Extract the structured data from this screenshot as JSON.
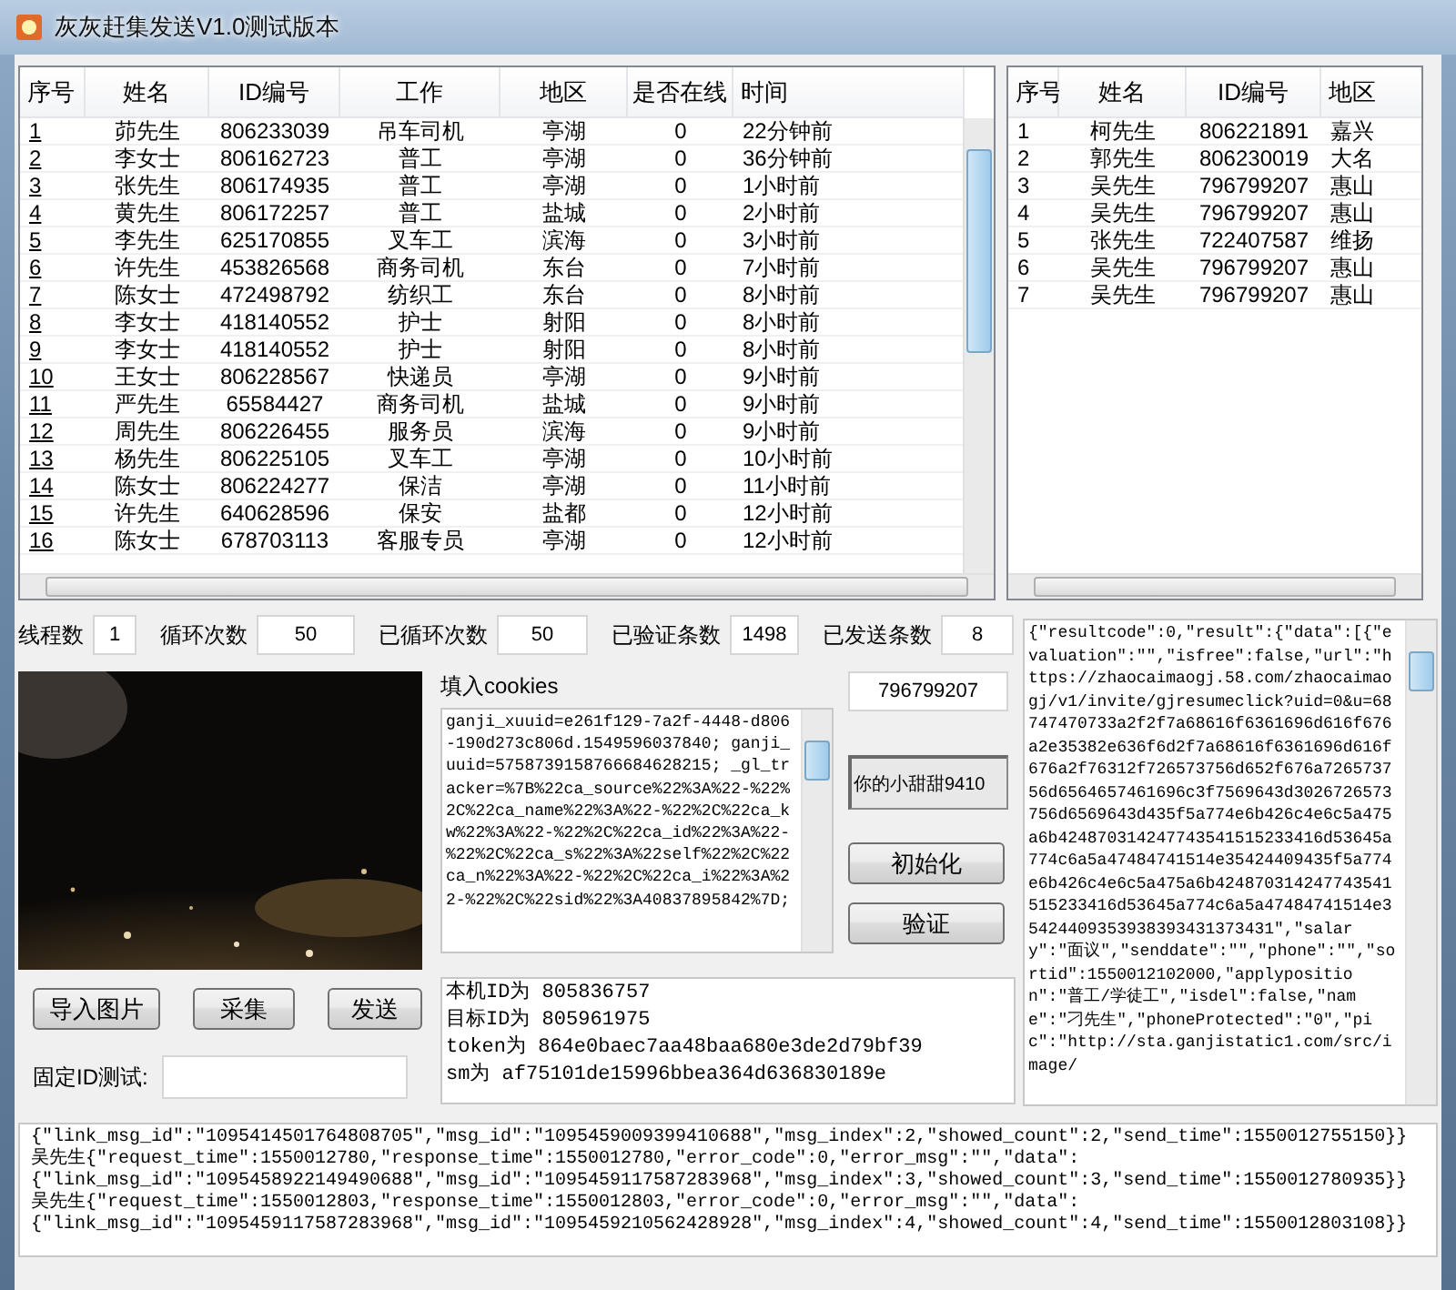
{
  "window": {
    "title": "灰灰赶集发送V1.0测试版本"
  },
  "main_table": {
    "linked_index": true,
    "columns": [
      "序号",
      "姓名",
      "ID编号",
      "工作",
      "地区",
      "是否在线",
      "时间"
    ],
    "rows": [
      [
        "1",
        "茆先生",
        "806233039",
        "吊车司机",
        "亭湖",
        "0",
        "22分钟前"
      ],
      [
        "2",
        "李女士",
        "806162723",
        "普工",
        "亭湖",
        "0",
        "36分钟前"
      ],
      [
        "3",
        "张先生",
        "806174935",
        "普工",
        "亭湖",
        "0",
        "1小时前"
      ],
      [
        "4",
        "黄先生",
        "806172257",
        "普工",
        "盐城",
        "0",
        "2小时前"
      ],
      [
        "5",
        "李先生",
        "625170855",
        "叉车工",
        "滨海",
        "0",
        "3小时前"
      ],
      [
        "6",
        "许先生",
        "453826568",
        "商务司机",
        "东台",
        "0",
        "7小时前"
      ],
      [
        "7",
        "陈女士",
        "472498792",
        "纺织工",
        "东台",
        "0",
        "8小时前"
      ],
      [
        "8",
        "李女士",
        "418140552",
        "护士",
        "射阳",
        "0",
        "8小时前"
      ],
      [
        "9",
        "李女士",
        "418140552",
        "护士",
        "射阳",
        "0",
        "8小时前"
      ],
      [
        "10",
        "王女士",
        "806228567",
        "快递员",
        "亭湖",
        "0",
        "9小时前"
      ],
      [
        "11",
        "严先生",
        "65584427",
        "商务司机",
        "盐城",
        "0",
        "9小时前"
      ],
      [
        "12",
        "周先生",
        "806226455",
        "服务员",
        "滨海",
        "0",
        "9小时前"
      ],
      [
        "13",
        "杨先生",
        "806225105",
        "叉车工",
        "亭湖",
        "0",
        "10小时前"
      ],
      [
        "14",
        "陈女士",
        "806224277",
        "保洁",
        "亭湖",
        "0",
        "11小时前"
      ],
      [
        "15",
        "许先生",
        "640628596",
        "保安",
        "盐都",
        "0",
        "12小时前"
      ],
      [
        "16",
        "陈女士",
        "678703113",
        "客服专员",
        "亭湖",
        "0",
        "12小时前"
      ]
    ]
  },
  "side_table": {
    "linked_index": false,
    "columns": [
      "序号",
      "姓名",
      "ID编号",
      "地区"
    ],
    "rows": [
      [
        "1",
        "柯先生",
        "806221891",
        "嘉兴"
      ],
      [
        "2",
        "郭先生",
        "806230019",
        "大名"
      ],
      [
        "3",
        "吴先生",
        "796799207",
        "惠山"
      ],
      [
        "4",
        "吴先生",
        "796799207",
        "惠山"
      ],
      [
        "5",
        "张先生",
        "722407587",
        "维扬"
      ],
      [
        "6",
        "吴先生",
        "796799207",
        "惠山"
      ],
      [
        "7",
        "吴先生",
        "796799207",
        "惠山"
      ]
    ]
  },
  "counters": [
    {
      "label": "线程数",
      "value": "1"
    },
    {
      "label": "循环次数",
      "value": "50"
    },
    {
      "label": "已循环次数",
      "value": "50"
    },
    {
      "label": "已验证条数",
      "value": "1498"
    },
    {
      "label": "已发送条数",
      "value": "8"
    }
  ],
  "banner": {
    "kind": "picture"
  },
  "left_buttons": [
    "导入图片",
    "采集",
    "发送"
  ],
  "fixed_id": {
    "label": "固定ID测试:"
  },
  "cookies": {
    "label": "填入cookies",
    "value": "ganji_xuuid=e261f129-7a2f-4448-d806-190d273c806d.1549596037840; ganji_uuid=5758739158766684628215; _gl_tracker=%7B%22ca_source%22%3A%22-%22%2C%22ca_name%22%3A%22-%22%2C%22ca_kw%22%3A%22-%22%2C%22ca_id%22%3A%22-%22%2C%22ca_s%22%3A%22self%22%2C%22ca_n%22%3A%22-%22%2C%22ca_i%22%3A%22-%22%2C%22sid%22%3A40837895842%7D;"
  },
  "id_field": {
    "value": "796799207"
  },
  "nickname_field": {
    "value": "你的小甜甜9410",
    "disabled": true
  },
  "action_buttons": [
    "初始化",
    "验证"
  ],
  "info_lines": [
    "本机ID为 805836757",
    "目标ID为 805961975",
    "token为 864e0baec7aa48baa680e3de2d79bf39",
    "sm为 af75101de15996bbea364d636830189e"
  ],
  "response": "{\"resultcode\":0,\"result\":{\"data\":[{\"evaluation\":\"\",\"isfree\":false,\"url\":\"https://zhaocaimaogj.58.com/zhaocaimaogj/v1/invite/gjresumeclick?uid=0&u=68747470733a2f2f7a68616f6361696d616f676a2e35382e636f6d2f7a68616f6361696d616f676a2f76312f726573756d652f676a726573756d6564657461696c3f7569643d3026726573756d6569643d435f5a774e6b426c4e6c5a475a6b424870314247743541515233416d53645a774c6a5a47484741514e35424409435f5a774e6b426c4e6c5a475a6b424870314247743541515233416d53645a774c6a5a47484741514e35424409353938393431373431\",\"salary\":\"面议\",\"senddate\":\"\",\"phone\":\"\",\"sortid\":1550012102000,\"applyposition\":\"普工/学徒工\",\"isdel\":false,\"name\":\"刁先生\",\"phoneProtected\":\"0\",\"pic\":\"http://sta.ganjistatic1.com/src/image/",
  "log_lines": [
    "{\"link_msg_id\":\"1095414501764808705\",\"msg_id\":\"1095459009399410688\",\"msg_index\":2,\"showed_count\":2,\"send_time\":1550012755150}}",
    "吴先生{\"request_time\":1550012780,\"response_time\":1550012780,\"error_code\":0,\"error_msg\":\"\",\"data\":",
    "{\"link_msg_id\":\"1095458922149490688\",\"msg_id\":\"1095459117587283968\",\"msg_index\":3,\"showed_count\":3,\"send_time\":1550012780935}}",
    "吴先生{\"request_time\":1550012803,\"response_time\":1550012803,\"error_code\":0,\"error_msg\":\"\",\"data\":",
    "{\"link_msg_id\":\"1095459117587283968\",\"msg_id\":\"1095459210562428928\",\"msg_index\":4,\"showed_count\":4,\"send_time\":1550012803108}}"
  ]
}
